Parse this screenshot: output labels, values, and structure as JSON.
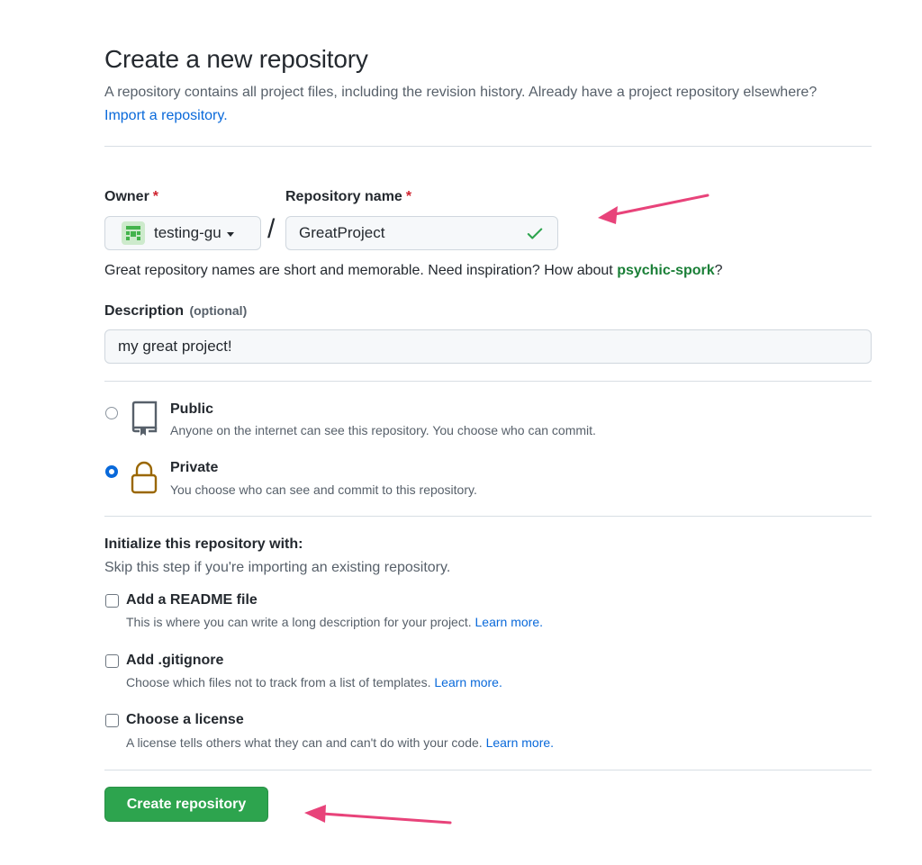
{
  "header": {
    "title": "Create a new repository",
    "description": "A repository contains all project files, including the revision history. Already have a project repository elsewhere?",
    "import_link": "Import a repository."
  },
  "owner": {
    "label": "Owner",
    "required_mark": "*",
    "value": "testing-gu"
  },
  "separator": "/",
  "repo_name": {
    "label": "Repository name",
    "required_mark": "*",
    "value": "GreatProject"
  },
  "name_hint": {
    "text": "Great repository names are short and memorable. Need inspiration? How about",
    "suggestion": "psychic-spork",
    "suffix": "?"
  },
  "description": {
    "label": "Description",
    "optional": "(optional)",
    "value": "my great project!"
  },
  "visibility": {
    "public": {
      "title": "Public",
      "desc": "Anyone on the internet can see this repository. You choose who can commit.",
      "selected": false
    },
    "private": {
      "title": "Private",
      "desc": "You choose who can see and commit to this repository.",
      "selected": true
    }
  },
  "initialize": {
    "title": "Initialize this repository with:",
    "subtitle": "Skip this step if you're importing an existing repository.",
    "options": [
      {
        "title": "Add a README file",
        "desc": "This is where you can write a long description for your project.",
        "link": "Learn more.",
        "checked": false
      },
      {
        "title": "Add .gitignore",
        "desc": "Choose which files not to track from a list of templates.",
        "link": "Learn more.",
        "checked": false
      },
      {
        "title": "Choose a license",
        "desc": "A license tells others what they can and can't do with your code.",
        "link": "Learn more.",
        "checked": false
      }
    ]
  },
  "create_button": "Create repository",
  "colors": {
    "accent_blue": "#0969da",
    "create_green": "#2da44e",
    "required_red": "#cf222e",
    "annotation_arrow": "#e8437a",
    "lock_icon": "#9a6700"
  },
  "icons": {
    "owner_avatar": "identicon-icon",
    "valid": "check-icon",
    "public": "repo-icon",
    "private": "lock-icon"
  }
}
